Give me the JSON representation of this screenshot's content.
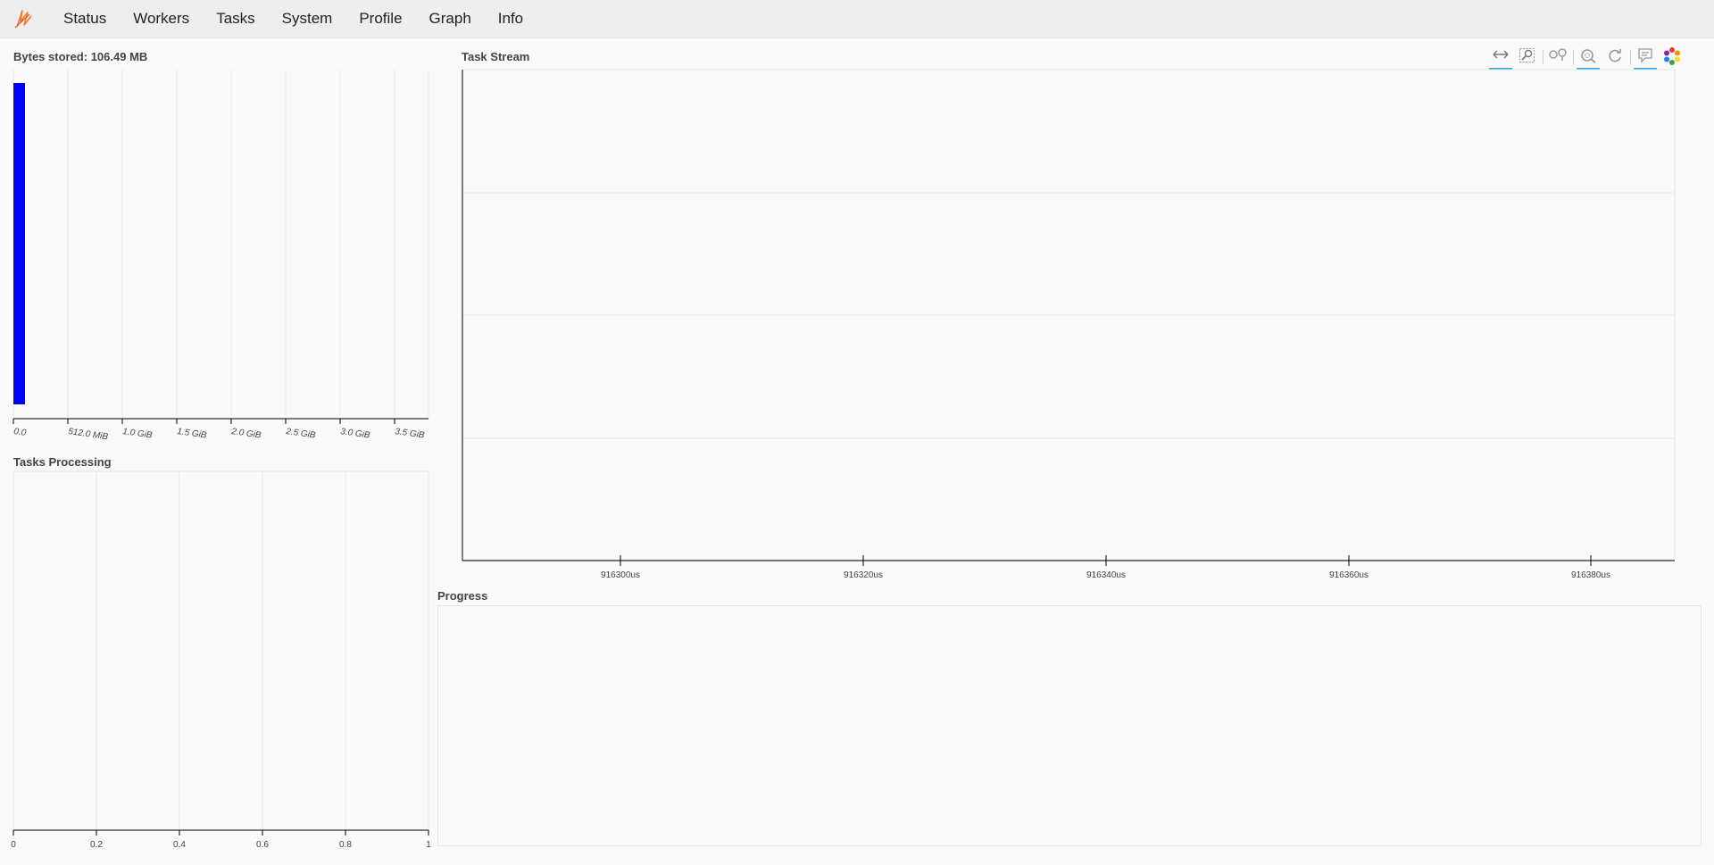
{
  "nav": {
    "logo_icon": "dask-logo-icon",
    "items": [
      "Status",
      "Workers",
      "Tasks",
      "System",
      "Profile",
      "Graph",
      "Info"
    ]
  },
  "bytes_stored": {
    "title": "Bytes stored: 106.49 MB",
    "tick_labels": [
      "0.0",
      "512.0 MiB",
      "1.0 GiB",
      "1.5 GiB",
      "2.0 GiB",
      "2.5 GiB",
      "3.0 GiB",
      "3.5 GiB"
    ],
    "bar_color": "#0000ff"
  },
  "tasks_processing": {
    "title": "Tasks Processing",
    "tick_labels": [
      "0",
      "0.2",
      "0.4",
      "0.6",
      "0.8",
      "1"
    ]
  },
  "task_stream": {
    "title": "Task Stream",
    "tick_labels": [
      "916300us",
      "916320us",
      "916340us",
      "916360us",
      "916380us"
    ],
    "toolbar": [
      {
        "icon": "xpan-icon",
        "active": true
      },
      {
        "icon": "box-zoom-icon",
        "active": false
      },
      {
        "icon": "reset-icon",
        "active": false
      },
      {
        "icon": "wheel-zoom-icon",
        "active": true
      },
      {
        "icon": "refresh-icon",
        "active": false
      },
      {
        "icon": "hover-icon",
        "active": true
      },
      {
        "icon": "bokeh-logo-icon",
        "active": false
      }
    ]
  },
  "progress": {
    "title": "Progress"
  },
  "chart_data": [
    {
      "type": "bar",
      "title": "Bytes stored: 106.49 MB",
      "orientation": "horizontal",
      "categories": [
        ""
      ],
      "values": [
        106.49
      ],
      "xlabel": "",
      "ylabel": "",
      "xticks": [
        "0.0",
        "512.0 MiB",
        "1.0 GiB",
        "1.5 GiB",
        "2.0 GiB",
        "2.5 GiB",
        "3.0 GiB",
        "3.5 GiB"
      ],
      "grid": true
    },
    {
      "type": "bar",
      "title": "Tasks Processing",
      "orientation": "horizontal",
      "categories": [],
      "values": [],
      "xlim": [
        0,
        1
      ],
      "xticks": [
        "0",
        "0.2",
        "0.4",
        "0.6",
        "0.8",
        "1"
      ],
      "grid": true
    },
    {
      "type": "bar",
      "title": "Task Stream",
      "categories": [],
      "values": [],
      "xticks": [
        "916300us",
        "916320us",
        "916340us",
        "916360us",
        "916380us"
      ],
      "grid": true
    }
  ]
}
